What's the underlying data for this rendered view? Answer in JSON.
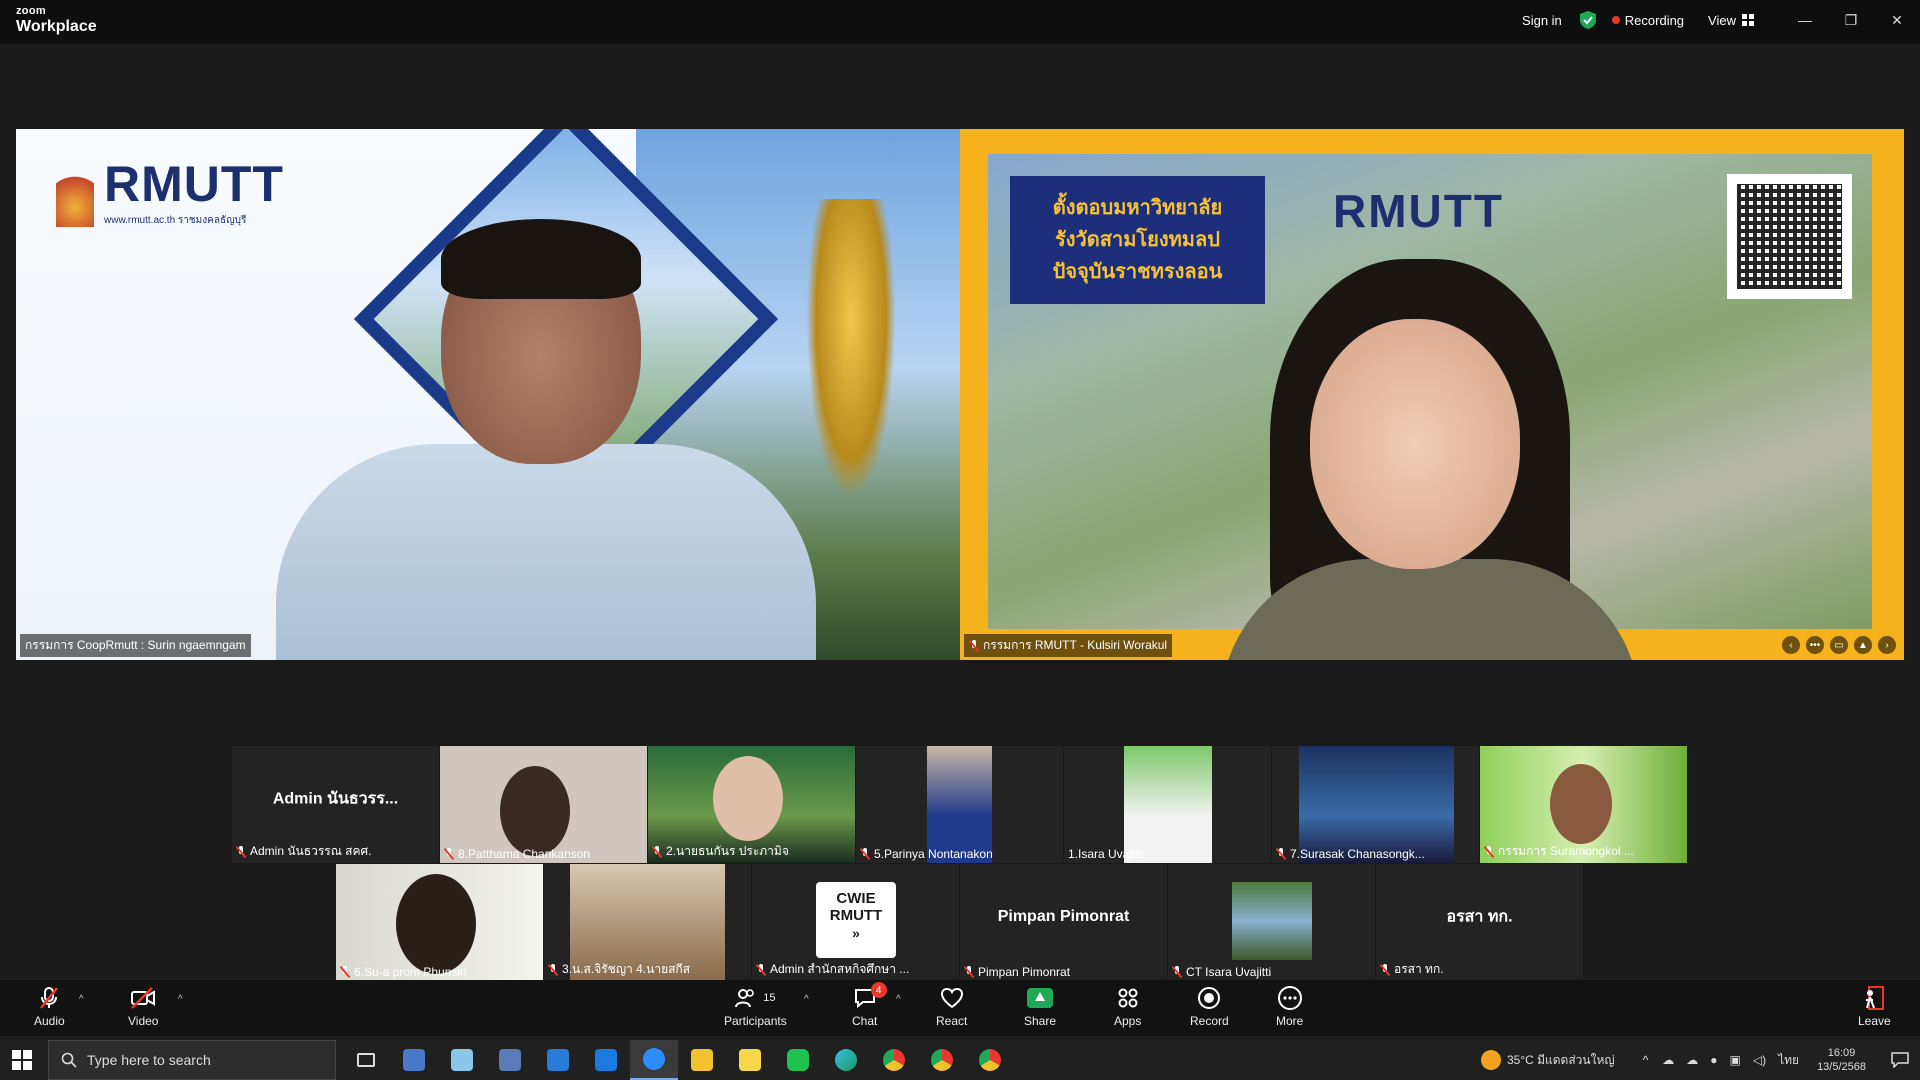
{
  "app": {
    "brand_top": "zoom",
    "brand_bottom": "Workplace",
    "sign_in": "Sign in",
    "recording": "Recording",
    "view": "View",
    "win_min": "—",
    "win_restore": "❐",
    "win_close": "✕"
  },
  "speakers": [
    {
      "name": "กรรมการ CoopRmutt : Surin ngaemngam",
      "logo_text": "RMUTT",
      "logo_sub": "www.rmutt.ac.th ราชมงคลธัญบุรี"
    },
    {
      "name": "กรรมการ RMUTT - Kulsiri Worakul",
      "slide_title": [
        "ตั้งตอบมหาวิทยาลัย",
        "รังวัดสามโยงทมลป",
        "ปัจจุบันราชทรงลอน"
      ],
      "slide_logo": "RMUTT"
    }
  ],
  "gallery_row1": [
    {
      "name": "Admin นันธวรรณ สคศ.",
      "center_label": "Admin นันธวรร...",
      "muted": true
    },
    {
      "name": "8.Patthama Chankanson",
      "muted": true
    },
    {
      "name": "2.นายธนกันร ประภามิจ",
      "muted": true
    },
    {
      "name": "5.Parinya Nontanakon",
      "muted": true
    },
    {
      "name": "1.Isara Uvajitti",
      "muted": false
    },
    {
      "name": "7.Surasak Chanasongk...",
      "muted": true
    },
    {
      "name": "กรรมการ Suramongkol ...",
      "muted": true
    }
  ],
  "gallery_row2": [
    {
      "name": "6.Su-a prom Phunsin",
      "muted": true
    },
    {
      "name": "3.น.ส.จิรัชญา 4.นายสกีส",
      "muted": true
    },
    {
      "name": "Admin สำนักสหกิจศึกษา ...",
      "muted": true,
      "logo_line1": "CWIE",
      "logo_line2": "RMUTT"
    },
    {
      "name": "Pimpan Pimonrat",
      "center_label": "Pimpan Pimonrat",
      "muted": true
    },
    {
      "name": "CT Isara Uvajitti",
      "muted": true
    },
    {
      "name": "อรสา ทก.",
      "center_label": "อรสา ทก.",
      "muted": true
    }
  ],
  "toolbar": {
    "audio": "Audio",
    "video": "Video",
    "participants": "Participants",
    "participants_count": "15",
    "chat": "Chat",
    "chat_badge": "4",
    "react": "React",
    "share": "Share",
    "apps": "Apps",
    "record": "Record",
    "more": "More",
    "leave": "Leave"
  },
  "taskbar": {
    "search_placeholder": "Type here to search",
    "weather": "35°C มีแดดส่วนใหญ่",
    "lang": "ไทย",
    "time": "16:09",
    "date": "13/5/2568"
  },
  "colors": {
    "accent_green": "#1fa855",
    "recording_red": "#e8372c",
    "slide_border": "#f5b21c",
    "rmutt_navy": "#1c2f6e"
  }
}
